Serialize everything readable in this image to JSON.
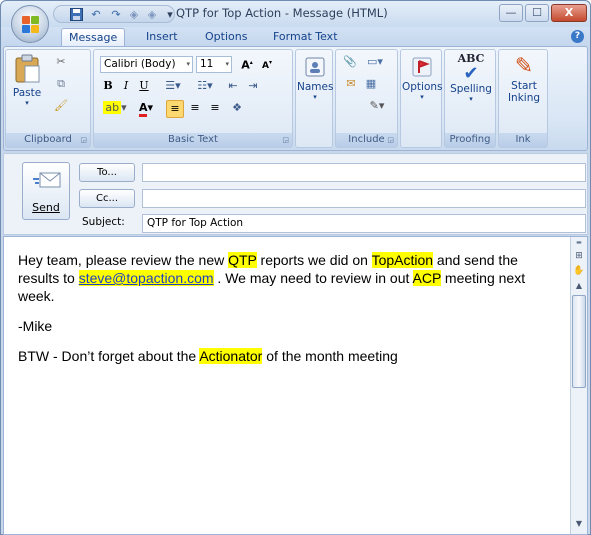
{
  "window": {
    "title": "QTP for Top Action - Message (HTML)",
    "minimize": "—",
    "maximize": "☐",
    "close": "X"
  },
  "qat": {
    "more": "▾"
  },
  "tabs": [
    {
      "label": "Message"
    },
    {
      "label": "Insert"
    },
    {
      "label": "Options"
    },
    {
      "label": "Format Text"
    }
  ],
  "help": "?",
  "ribbon": {
    "clipboard": {
      "label": "Clipboard",
      "paste": "Paste"
    },
    "basic_text": {
      "label": "Basic Text",
      "font": "Calibri (Body)",
      "size": "11",
      "bold": "B",
      "italic": "I",
      "underline": "U"
    },
    "names": {
      "label": "Names"
    },
    "include": {
      "label": "Include"
    },
    "options": {
      "label": "Options"
    },
    "proofing": {
      "label": "Proofing",
      "spelling": "Spelling",
      "abc": "ABC"
    },
    "ink": {
      "label": "Ink",
      "start_line1": "Start",
      "start_line2": "Inking"
    }
  },
  "header": {
    "send": "Send",
    "to": "To...",
    "cc": "Cc...",
    "subject_label": "Subject:",
    "to_value": "",
    "cc_value": "",
    "subject_value": "QTP for Top Action"
  },
  "body": {
    "p1": {
      "a": "Hey team, please review the new ",
      "b": "QTP",
      "c": " reports we did on ",
      "d": "TopAction",
      "e": " and send the results to ",
      "f": "steve@topaction.com",
      "g": " . We may need to review in out ",
      "h": "ACP",
      "i": " meeting next week."
    },
    "p2": "-Mike",
    "p3": {
      "a": "BTW - Don’t forget about the ",
      "b": "Actionator",
      "c": " of the month meeting"
    }
  },
  "colors": {
    "highlight": "#ffff00",
    "ribbon": "#dae6f4",
    "link": "#1f3fc0"
  }
}
